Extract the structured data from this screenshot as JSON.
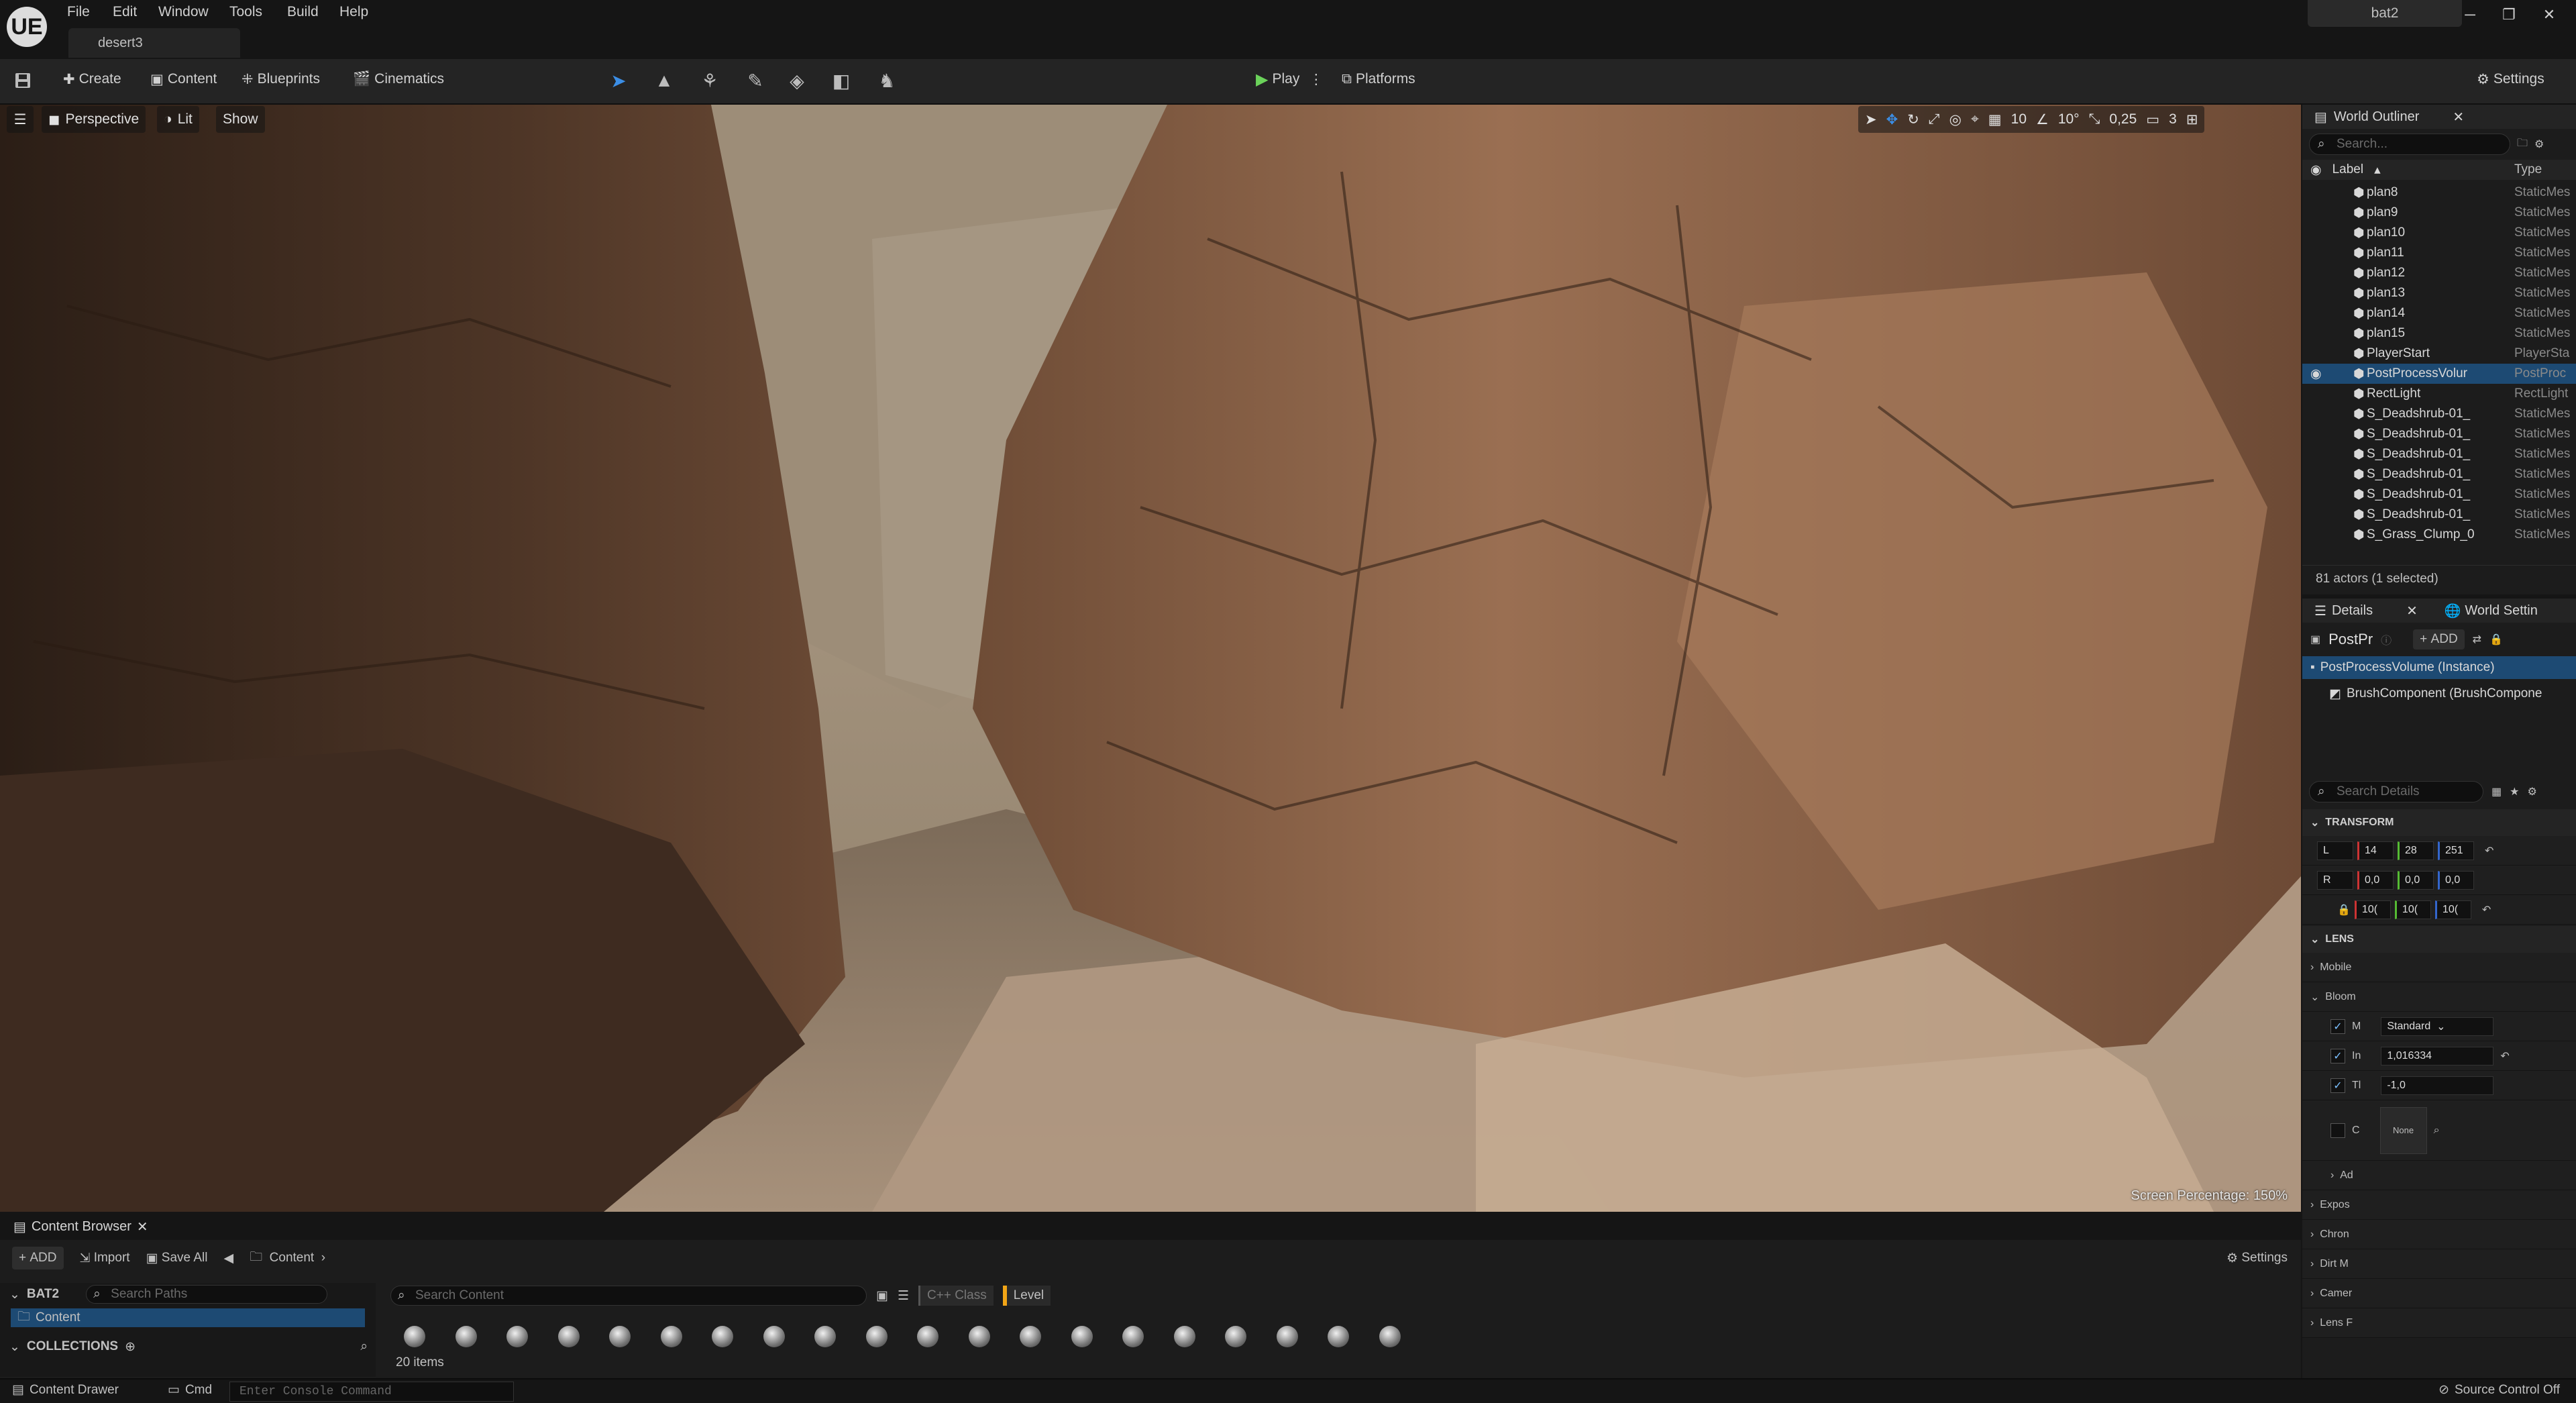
{
  "app": {
    "logo": "UE",
    "document_tab": "desert3",
    "project": "bat2"
  },
  "menu": [
    "File",
    "Edit",
    "Window",
    "Tools",
    "Build",
    "Help"
  ],
  "window_controls": {
    "minimize": "─",
    "maximize": "❐",
    "close": "✕"
  },
  "toolbar": {
    "create": "Create",
    "content": "Content",
    "blueprints": "Blueprints",
    "cinematics": "Cinematics",
    "play": "Play",
    "platforms": "Platforms",
    "settings": "Settings"
  },
  "viewport": {
    "perspective": "Perspective",
    "lit": "Lit",
    "show": "Show",
    "grid_snap": "10",
    "rotation_snap": "10°",
    "scale_snap": "0,25",
    "camera_speed": "3",
    "screen_percentage": "Screen Percentage: 150%"
  },
  "outliner": {
    "title": "World Outliner",
    "search_placeholder": "Search...",
    "col_label": "Label",
    "col_type": "Type",
    "rows": [
      {
        "label": "plan8",
        "type": "StaticMes"
      },
      {
        "label": "plan9",
        "type": "StaticMes"
      },
      {
        "label": "plan10",
        "type": "StaticMes"
      },
      {
        "label": "plan11",
        "type": "StaticMes"
      },
      {
        "label": "plan12",
        "type": "StaticMes"
      },
      {
        "label": "plan13",
        "type": "StaticMes"
      },
      {
        "label": "plan14",
        "type": "StaticMes"
      },
      {
        "label": "plan15",
        "type": "StaticMes"
      },
      {
        "label": "PlayerStart",
        "type": "PlayerSta"
      },
      {
        "label": "PostProcessVolur",
        "type": "PostProc"
      },
      {
        "label": "RectLight",
        "type": "RectLight"
      },
      {
        "label": "S_Deadshrub-01_",
        "type": "StaticMes"
      },
      {
        "label": "S_Deadshrub-01_",
        "type": "StaticMes"
      },
      {
        "label": "S_Deadshrub-01_",
        "type": "StaticMes"
      },
      {
        "label": "S_Deadshrub-01_",
        "type": "StaticMes"
      },
      {
        "label": "S_Deadshrub-01_",
        "type": "StaticMes"
      },
      {
        "label": "S_Deadshrub-01_",
        "type": "StaticMes"
      },
      {
        "label": "S_Grass_Clump_0",
        "type": "StaticMes"
      }
    ],
    "status": "81 actors (1 selected)"
  },
  "details": {
    "tab": "Details",
    "tab2": "World Settin",
    "actor_name": "PostPr",
    "add": "ADD",
    "components": [
      "PostProcessVolume (Instance)",
      "BrushComponent (BrushCompone"
    ],
    "search_placeholder": "Search Details",
    "transform": {
      "title": "TRANSFORM",
      "location_label": "L",
      "rotation_label": "R",
      "location": [
        "14",
        "28",
        "251"
      ],
      "rotation": [
        "0,0",
        "0,0",
        "0,0"
      ],
      "scale": [
        "10(",
        "10(",
        "10("
      ]
    },
    "lens": {
      "title": "LENS",
      "mobile": "Mobile",
      "bloom": "Bloom",
      "method_label": "M",
      "method": "Standard",
      "intensity_label": "In",
      "intensity": "1,016334",
      "threshold_label": "Tl",
      "threshold": "-1,0",
      "convolution_label": "C",
      "texture": "None",
      "advanced": "Ad"
    },
    "more": [
      "Expos",
      "Chron",
      "Dirt M",
      "Camer",
      "Lens F"
    ]
  },
  "content_browser": {
    "title": "Content Browser",
    "add": "ADD",
    "import": "Import",
    "save_all": "Save All",
    "path": "Content",
    "settings": "Settings",
    "project": "BAT2",
    "search_paths": "Search Paths",
    "folder": "Content",
    "collections": "COLLECTIONS",
    "search_content": "Search Content",
    "filter_cpp": "C++ Class",
    "filter_level": "Level",
    "count": "20 items"
  },
  "statusbar": {
    "content_drawer": "Content Drawer",
    "cmd": "Cmd",
    "console_placeholder": "Enter Console Command",
    "source_control": "Source Control Off"
  },
  "colors": {
    "accent": "#1d4a73",
    "play_green": "#6bd25a",
    "level_filter": "#f2a516"
  }
}
